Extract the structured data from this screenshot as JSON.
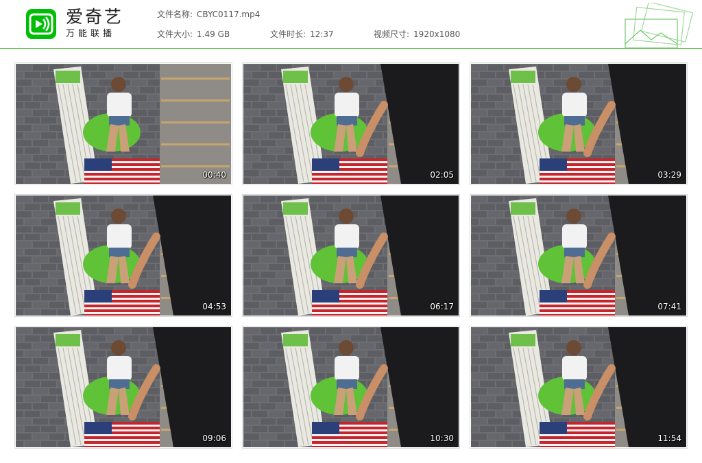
{
  "brand": {
    "name": "爱奇艺",
    "subtitle": "万能联播",
    "accent_color": "#00be06",
    "line_color": "#49b93a"
  },
  "file_info": {
    "name_label": "文件名称:",
    "name_value": "CBYC0117.mp4",
    "size_label": "文件大小:",
    "size_value": "1.49 GB",
    "duration_label": "文件时长:",
    "duration_value": "12:37",
    "resolution_label": "视频尺寸:",
    "resolution_value": "1920x1080"
  },
  "thumbnails": [
    {
      "timestamp": "00:40"
    },
    {
      "timestamp": "02:05"
    },
    {
      "timestamp": "03:29"
    },
    {
      "timestamp": "04:53"
    },
    {
      "timestamp": "06:17"
    },
    {
      "timestamp": "07:41"
    },
    {
      "timestamp": "09:06"
    },
    {
      "timestamp": "10:30"
    },
    {
      "timestamp": "11:54"
    }
  ],
  "icons": {
    "logo": "iqiyi-logo-icon",
    "decoration": "photo-stack-icon"
  }
}
